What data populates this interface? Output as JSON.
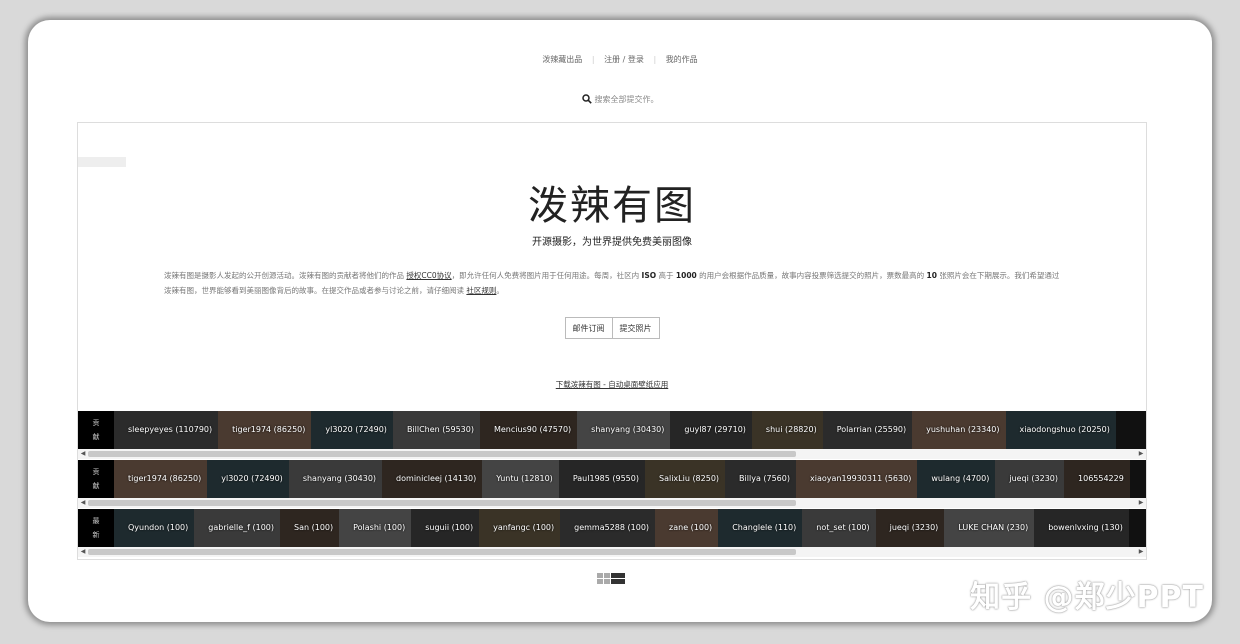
{
  "topnav": {
    "items": [
      "泼辣藏出品",
      "注册 / 登录",
      "我的作品"
    ]
  },
  "search": {
    "placeholder": "搜索全部提交作。"
  },
  "hero": {
    "title": "泼辣有图",
    "subtitle": "开源摄影，为世界提供免费美丽图像"
  },
  "desc": {
    "p1": "泼辣有图是摄影人发起的公开创源活动。泼辣有图的贡献者将他们的作品 ",
    "link_license": "授权CC0协议",
    "p2": "，即允许任何人免费将图片用于任何用途。每周，社区内 ",
    "iso": "ISO",
    "p3": " 高于 ",
    "num1000": "1000",
    "p4": " 的用户会根据作品质量，故事内容投票筛选提交的照片，票数最高的 ",
    "num10": "10",
    "p5": " 张照片会在下期展示。我们希望通过泼辣有图，世界能够看到美丽图像背后的故事。在提交作品或者参与讨论之前，请仔细阅读 ",
    "link_rules": "社区规则",
    "p6": "。"
  },
  "buttons": {
    "subscribe": "邮件订阅",
    "submit": "提交照片"
  },
  "download_link": "下载泼辣有图 - 自动桌面壁纸应用",
  "strips": [
    {
      "label": [
        "贡",
        "献"
      ],
      "items": [
        "sleepyeyes (110790)",
        "tiger1974 (86250)",
        "yl3020 (72490)",
        "BillChen (59530)",
        "Mencius90 (47570)",
        "shanyang (30430)",
        "guyl87 (29710)",
        "shui (28820)",
        "Polarrian (25590)",
        "yushuhan (23340)",
        "xiaodongshuo (20250)"
      ]
    },
    {
      "label": [
        "贡",
        "献"
      ],
      "items": [
        "tiger1974 (86250)",
        "yl3020 (72490)",
        "shanyang (30430)",
        "dominicleej (14130)",
        "Yuntu (12810)",
        "Paul1985 (9550)",
        "SalixLiu (8250)",
        "Billya (7560)",
        "xiaoyan19930311 (5630)",
        "wulang (4700)",
        "jueqi (3230)",
        "106554229"
      ]
    },
    {
      "label": [
        "最",
        "新"
      ],
      "items": [
        "Qyundon (100)",
        "gabrielle_f (100)",
        "San (100)",
        "Polashi (100)",
        "suguii (100)",
        "yanfangc (100)",
        "gemma5288 (100)",
        "zane (100)",
        "Changlele (110)",
        "not_set (100)",
        "jueqi (3230)",
        "LUKE CHAN (230)",
        "bowenlvxing (130)"
      ]
    }
  ],
  "watermark": "知乎 @郑少PPT",
  "icons": {
    "search": "search-icon",
    "grid": "grid-view-icon",
    "list": "list-view-icon"
  }
}
